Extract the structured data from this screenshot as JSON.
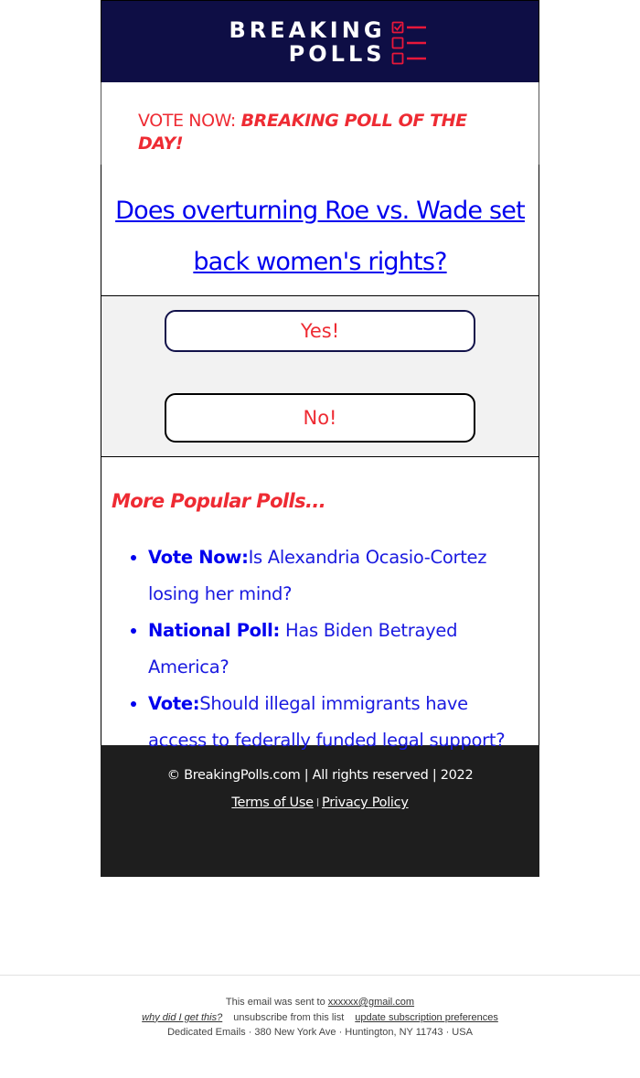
{
  "header": {
    "logo_line1": "BREAKING",
    "logo_line2": "POLLS",
    "logo_icon": "checklist-icon",
    "colors": {
      "background": "#0e0e45",
      "accent": "#e8173a"
    }
  },
  "kicker": {
    "prefix": "VOTE NOW: ",
    "emphasis": "BREAKING POLL OF THE DAY!"
  },
  "question": {
    "text": "Does overturning Roe vs. Wade set back women's rights?"
  },
  "answers": [
    {
      "label": "Yes!"
    },
    {
      "label": "No!"
    }
  ],
  "more_polls": {
    "title": "More Popular Polls...",
    "items": [
      {
        "prefix": "Vote Now:",
        "text": "Is Alexandria Ocasio-Cortez losing her mind?"
      },
      {
        "prefix": "National Poll:",
        "text": " Has Biden Betrayed America?"
      },
      {
        "prefix": "Vote:",
        "text": "Should illegal immigrants have access to federally funded legal support?"
      }
    ]
  },
  "footer": {
    "copyright": "© BreakingPolls.com | All rights reserved | 2022",
    "terms_label": "Terms of Use",
    "separator": "I",
    "privacy_label": "Privacy Policy"
  },
  "meta": {
    "sent_to_prefix": "This email was sent to ",
    "email": "xxxxxx@gmail.com",
    "why_label": "why did I get this?",
    "unsubscribe_label": "unsubscribe from this list",
    "update_prefs_label": "update subscription preferences",
    "address": "Dedicated Emails · 380 New York Ave · Huntington, NY 11743 · USA"
  },
  "colors": {
    "red": "#ee2b33",
    "link_blue": "#0000ee",
    "footer_bg": "#1e1e1e",
    "answers_bg": "#f2f2f2"
  }
}
